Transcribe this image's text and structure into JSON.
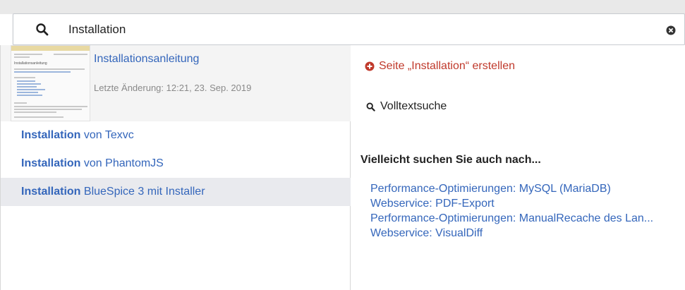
{
  "search": {
    "value": "Installation"
  },
  "featured": {
    "title": "Installationsanleitung",
    "subtitle": "Letzte Änderung: 12:21, 23. Sep. 2019",
    "thumb_heading": "Installationsanleitung"
  },
  "results": [
    {
      "bold": "Installation",
      "rest": " von Texvc"
    },
    {
      "bold": "Installation",
      "rest": " von PhantomJS"
    },
    {
      "bold": "Installation",
      "rest": " BlueSpice 3 mit Installer"
    }
  ],
  "right": {
    "create_label": "Seite „Installation“ erstellen",
    "fulltext_label": "Volltextsuche",
    "suggest_heading": "Vielleicht suchen Sie auch nach...",
    "suggestions": [
      "Performance-Optimierungen: MySQL (MariaDB)",
      "Webservice: PDF-Export",
      "Performance-Optimierungen: ManualRecache des Lan...",
      "Webservice: VisualDiff"
    ]
  },
  "colors": {
    "link": "#3466bb",
    "create": "#c0392b",
    "active_row": "#e9eaee"
  },
  "icons": {
    "search": "magnifier",
    "clear": "circle-x",
    "create": "circle-plus",
    "fulltext": "magnifier"
  }
}
